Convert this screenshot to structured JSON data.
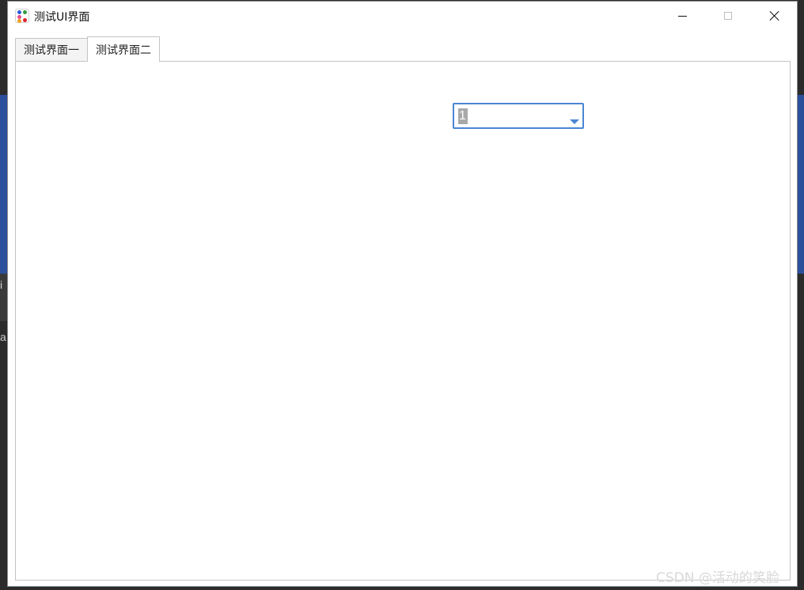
{
  "window": {
    "title": "测试UI界面",
    "icon": "app-grid-icon"
  },
  "tabs": [
    {
      "label": "测试界面一",
      "active": false
    },
    {
      "label": "测试界面二",
      "active": true
    }
  ],
  "combo": {
    "value": "1"
  },
  "background": {
    "letter_1": "i",
    "letter_2": "a"
  },
  "watermark": "CSDN @活动的笑脸",
  "colors": {
    "accent": "#4a86d4",
    "desktop_blue": "#2c4f9c"
  }
}
